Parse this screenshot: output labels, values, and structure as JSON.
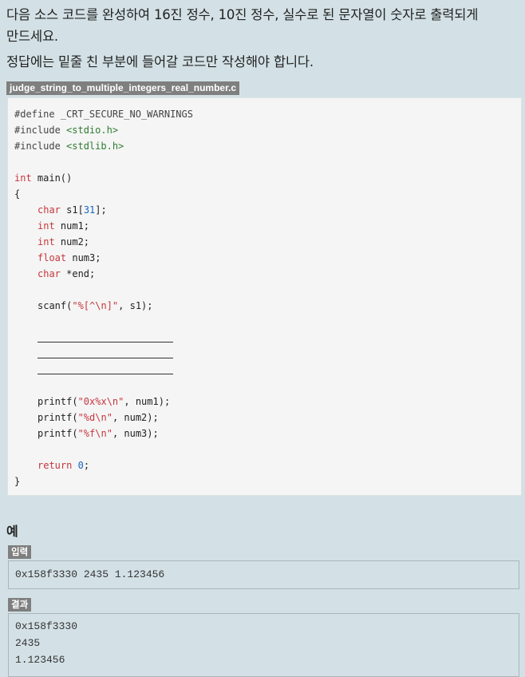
{
  "problem": {
    "intro_line1": "다음 소스 코드를 완성하여 16진 정수, 10진 정수, 실수로 된 문자열이 숫자로 출력되게",
    "intro_line2": "만드세요.",
    "note": "정답에는 밑줄 친 부분에 들어갈 코드만 작성해야 합니다."
  },
  "code": {
    "filename": "judge_string_to_multiple_integers_real_number.c",
    "lines": {
      "define": "#define _CRT_SECURE_NO_WARNINGS",
      "include1_kw": "#include ",
      "include1_hdr": "<stdio.h>",
      "include2_kw": "#include ",
      "include2_hdr": "<stdlib.h>",
      "main_type": "int",
      "main_rest": " main()",
      "open_brace": "{",
      "decl1_type": "char",
      "decl1_rest1": " s1[",
      "decl1_num": "31",
      "decl1_rest2": "];",
      "decl2_type": "int",
      "decl2_rest": " num1;",
      "decl3_type": "int",
      "decl3_rest": " num2;",
      "decl4_type": "float",
      "decl4_rest": " num3;",
      "decl5_type": "char",
      "decl5_rest": " *end;",
      "scanf_fn": "scanf(",
      "scanf_fmt": "\"%[^\\n]\"",
      "scanf_rest": ", s1);",
      "printf1_fn": "printf(",
      "printf1_fmt": "\"0x%x\\n\"",
      "printf1_rest": ", num1);",
      "printf2_fn": "printf(",
      "printf2_fmt": "\"%d\\n\"",
      "printf2_rest": ", num2);",
      "printf3_fn": "printf(",
      "printf3_fmt": "\"%f\\n\"",
      "printf3_rest": ", num3);",
      "return_kw": "return",
      "return_sp": " ",
      "return_num": "0",
      "return_semi": ";",
      "close_brace": "}"
    }
  },
  "example": {
    "heading": "예",
    "input_tag": "입력",
    "input_value": "0x158f3330 2435 1.123456",
    "result_tag": "결과",
    "result_lines": [
      "0x158f3330",
      "2435",
      "1.123456"
    ]
  },
  "colors": {
    "background": "#d3e1e6",
    "code_background": "#f5f5f5",
    "keyword": "#c6373d",
    "string": "#2e7d32",
    "number": "#1565c0",
    "badge": "#7f7f7f"
  }
}
